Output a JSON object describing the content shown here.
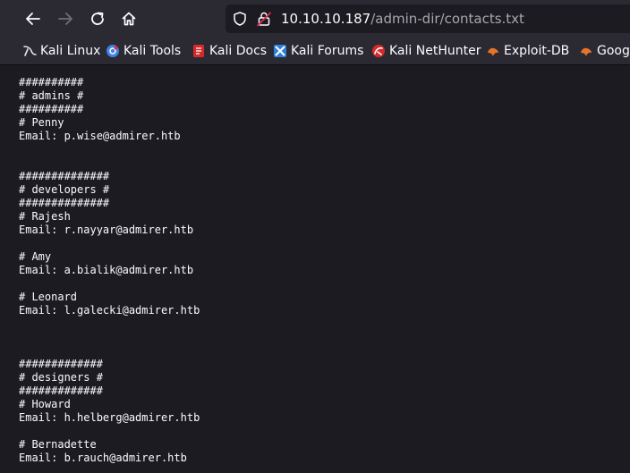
{
  "browser": {
    "url_host": "10.10.10.187",
    "url_path": "/admin-dir/contacts.txt",
    "icons": {
      "back": "arrow-left-icon",
      "forward": "arrow-right-icon",
      "reload": "reload-icon",
      "home": "home-icon",
      "site_info": "shield-icon",
      "connection": "insecure-lock-icon"
    }
  },
  "bookmarks": [
    {
      "label": "Kali Linux",
      "icon": "kali-dragon-icon"
    },
    {
      "label": "Kali Tools",
      "icon": "kali-tools-icon"
    },
    {
      "label": "Kali Docs",
      "icon": "kali-docs-icon"
    },
    {
      "label": "Kali Forums",
      "icon": "kali-forums-icon"
    },
    {
      "label": "Kali NetHunter",
      "icon": "kali-nethunter-icon"
    },
    {
      "label": "Exploit-DB",
      "icon": "exploit-db-icon"
    },
    {
      "label": "Goog",
      "icon": "google-hacking-db-icon"
    }
  ],
  "document": {
    "text": "##########\n# admins #\n##########\n# Penny\nEmail: p.wise@admirer.htb\n\n\n##############\n# developers #\n##############\n# Rajesh\nEmail: r.nayyar@admirer.htb\n\n# Amy\nEmail: a.bialik@admirer.htb\n\n# Leonard\nEmail: l.galecki@admirer.htb\n\n\n\n#############\n# designers #\n#############\n# Howard\nEmail: h.helberg@admirer.htb\n\n# Bernadette\nEmail: b.rauch@admirer.htb"
  },
  "colors": {
    "toolbar_bg": "#2b2a33",
    "page_bg": "#1c1b22",
    "text": "#fbfbfe",
    "url_path": "#a7a6ad"
  }
}
